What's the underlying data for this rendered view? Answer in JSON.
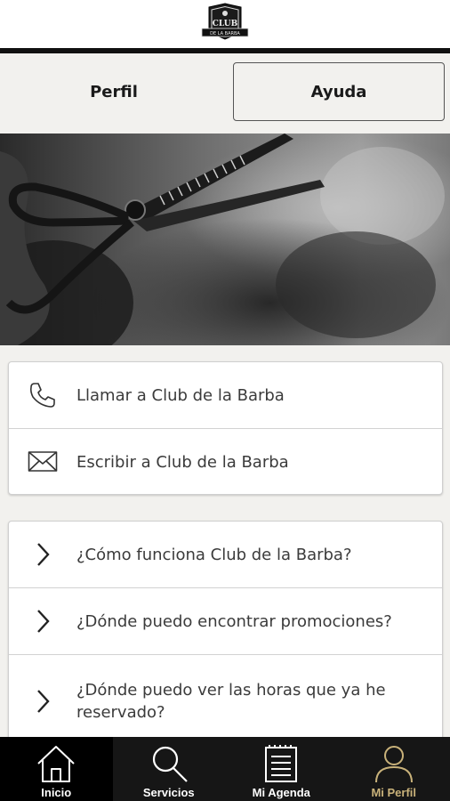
{
  "header": {
    "logo_text": "CLUB",
    "logo_subtext": "DE LA BARBA"
  },
  "tabs": [
    {
      "label": "Perfil",
      "selected": false
    },
    {
      "label": "Ayuda",
      "selected": true
    }
  ],
  "contact": [
    {
      "label": "Llamar a Club de la Barba",
      "icon": "phone-icon"
    },
    {
      "label": "Escribir a Club de la Barba",
      "icon": "envelope-icon"
    }
  ],
  "faq": [
    {
      "label": "¿Cómo funciona Club de la Barba?",
      "icon": "chevron-right-icon"
    },
    {
      "label": "¿Dónde puedo encontrar promociones?",
      "icon": "chevron-right-icon"
    },
    {
      "label": "¿Dónde puedo ver las horas que ya he reservado?",
      "icon": "chevron-right-icon"
    }
  ],
  "bottom_nav": [
    {
      "label": "Inicio",
      "icon": "home-icon"
    },
    {
      "label": "Servicios",
      "icon": "search-icon"
    },
    {
      "label": "Mi Agenda",
      "icon": "calendar-icon"
    },
    {
      "label": "Mi Perfil",
      "icon": "user-icon",
      "active": true
    }
  ],
  "colors": {
    "active_nav": "#c9b27a",
    "bar": "#111111",
    "background": "#f2f1ee"
  }
}
